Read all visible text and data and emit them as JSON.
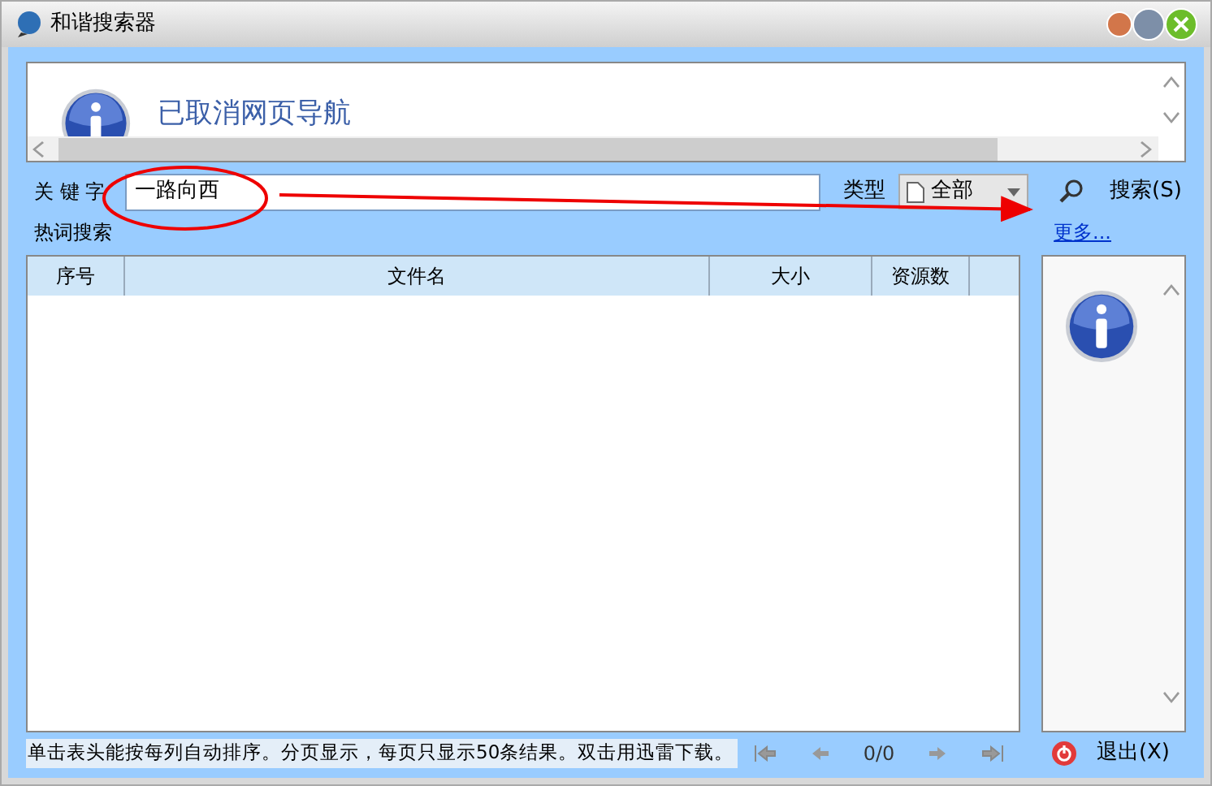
{
  "window": {
    "title": "和谐搜索器"
  },
  "browser_pane": {
    "message": "已取消网页导航"
  },
  "search_bar": {
    "keyword_label": "关 键 字",
    "keyword_value": "一路向西",
    "type_label": "类型",
    "type_value": "全部",
    "search_button": "搜索(S)",
    "hot_label": "热词搜索",
    "more_link": "更多..."
  },
  "table": {
    "columns": [
      "序号",
      "文件名",
      "大小",
      "资源数"
    ]
  },
  "status_bar": {
    "hint": "单击表头能按每列自动排序。分页显示，每页只显示50条结果。双击用迅雷下载。",
    "page": "0/0",
    "exit_button": "退出(X)"
  }
}
